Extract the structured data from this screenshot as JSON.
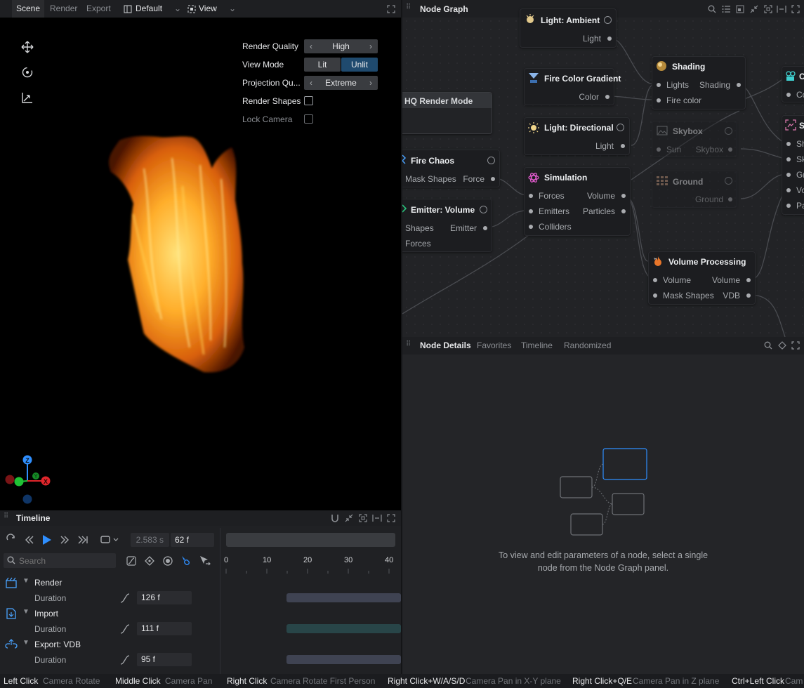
{
  "scene_tabs": [
    "Scene",
    "Render",
    "Export"
  ],
  "layout_preset": "Default",
  "view_menu": "View",
  "viewport": {
    "render_quality": {
      "label": "Render Quality",
      "value": "High"
    },
    "view_mode": {
      "label": "View Mode",
      "options": [
        "Lit",
        "Unlit"
      ],
      "selected": "Unlit"
    },
    "projection_quality": {
      "label": "Projection Qu...",
      "value": "Extreme"
    },
    "render_shapes": {
      "label": "Render Shapes",
      "checked": false
    },
    "lock_camera": {
      "label": "Lock Camera",
      "checked": false
    },
    "gizmo_labels": {
      "z": "Z",
      "y": "Y",
      "x": "X"
    }
  },
  "timeline": {
    "title": "Timeline",
    "time_seconds": "2.583 s",
    "frame": "62 f",
    "search_placeholder": "Search",
    "ruler": [
      "0",
      "10",
      "20",
      "30",
      "40"
    ],
    "groups": [
      {
        "name": "Render",
        "param": "Duration",
        "value": "126 f",
        "color": "#3f4352"
      },
      {
        "name": "Import",
        "param": "Duration",
        "value": "111 f",
        "color": "#284548"
      },
      {
        "name": "Export: VDB",
        "param": "Duration",
        "value": "95 f",
        "color": "#3f4352"
      }
    ]
  },
  "node_graph": {
    "title": "Node Graph",
    "nodes": {
      "light_ambient": {
        "title": "Light: Ambient",
        "out": "Light"
      },
      "shading": {
        "title": "Shading",
        "in1": "Lights",
        "out1": "Shading",
        "in2": "Fire color"
      },
      "fire_color_gradient": {
        "title": "Fire Color Gradient",
        "out": "Color"
      },
      "hq_render_mode": {
        "title": "HQ Render Mode"
      },
      "light_directional": {
        "title": "Light: Directional",
        "out": "Light"
      },
      "skybox": {
        "title": "Skybox",
        "in": "Sun",
        "out": "Skybox"
      },
      "fire_chaos": {
        "title": "Fire Chaos",
        "in": "Mask Shapes",
        "out": "Force"
      },
      "simulation": {
        "title": "Simulation",
        "in1": "Forces",
        "out1": "Volume",
        "in2": "Emitters",
        "out2": "Particles",
        "in3": "Colliders"
      },
      "ground": {
        "title": "Ground",
        "out": "Ground"
      },
      "emitter_volume": {
        "title": "Emitter: Volume",
        "in1": "Shapes",
        "out1": "Emitter",
        "in2": "Forces"
      },
      "volume_processing": {
        "title": "Volume Processing",
        "in1": "Volume",
        "out1": "Volume",
        "in2": "Mask Shapes",
        "out2": "VDB"
      },
      "partial_right": {
        "title": "S",
        "title2": "C",
        "ports": [
          "Co",
          "Sh",
          "Sk",
          "Gr",
          "Vo",
          "Pa"
        ]
      }
    }
  },
  "details": {
    "tabs": [
      "Node Details",
      "Favorites",
      "Timeline",
      "Randomized"
    ],
    "message": "To view and edit parameters of a node, select a single node from the Node Graph panel."
  },
  "status_bar": [
    {
      "key": "Left Click",
      "value": "Camera Rotate"
    },
    {
      "key": "Middle Click",
      "value": "Camera Pan"
    },
    {
      "key": "Right Click",
      "value": "Camera Rotate First Person"
    },
    {
      "key": "Right Click+W/A/S/D",
      "value": "Camera Pan in X-Y plane"
    },
    {
      "key": "Right Click+Q/E",
      "value": "Camera Pan in Z plane"
    },
    {
      "key": "Ctrl+Left Click",
      "value": "Cam"
    }
  ],
  "colors": {
    "accent": "#2f8fff",
    "selected_segment": "#1f4a6e",
    "viewport_bg": "#000000"
  }
}
